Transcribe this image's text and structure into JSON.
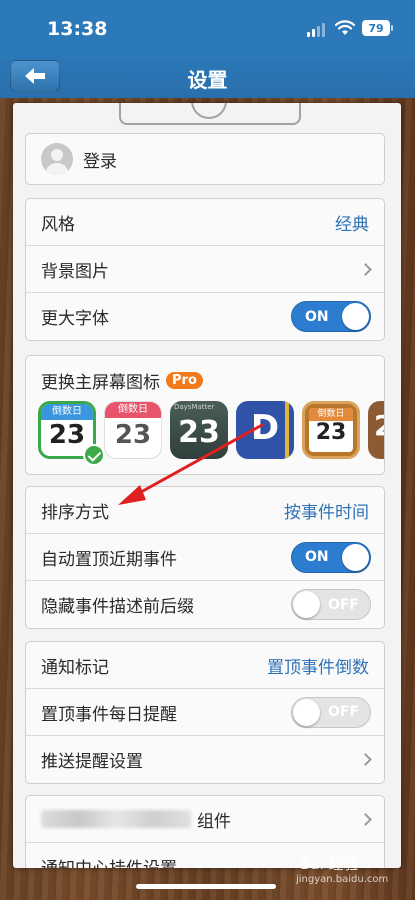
{
  "status_bar": {
    "time": "13:38",
    "battery": "79"
  },
  "nav": {
    "title": "设置",
    "back_icon": "arrow-left-icon"
  },
  "account": {
    "login_label": "登录"
  },
  "appearance": {
    "style_label": "风格",
    "style_value": "经典",
    "background_label": "背景图片",
    "font_label": "更大字体",
    "font_toggle": "ON"
  },
  "home_icon": {
    "title": "更换主屏幕图标",
    "pro_badge": "Pro",
    "icons": [
      {
        "band": "倒数日",
        "num": "23"
      },
      {
        "band": "倒数日",
        "num": "23"
      },
      {
        "brand": "DaysMatter",
        "num": "23"
      },
      {
        "num": "D"
      },
      {
        "band": "倒数日",
        "num": "23"
      },
      {
        "num": "2"
      }
    ]
  },
  "sorting": {
    "sort_label": "排序方式",
    "sort_value": "按事件时间",
    "auto_top_label": "自动置顶近期事件",
    "auto_top_toggle": "ON",
    "hide_affix_label": "隐藏事件描述前后缀",
    "hide_affix_toggle": "OFF"
  },
  "notify": {
    "badge_label": "通知标记",
    "badge_value": "置顶事件倒数",
    "daily_label": "置顶事件每日提醒",
    "daily_toggle": "OFF",
    "push_label": "推送提醒设置"
  },
  "widgets": {
    "widget_label": "组件",
    "notify_center_label": "通知中心挂件设置"
  },
  "watermark": {
    "text": "Bai 经验",
    "url": "jingyan.baidu.com"
  },
  "colors": {
    "nav_blue": "#2b79b8",
    "link_blue": "#2f73b5",
    "toggle_on": "#2c7cd0",
    "pro_orange": "#f07a1c",
    "arrow_red": "#e02020"
  }
}
